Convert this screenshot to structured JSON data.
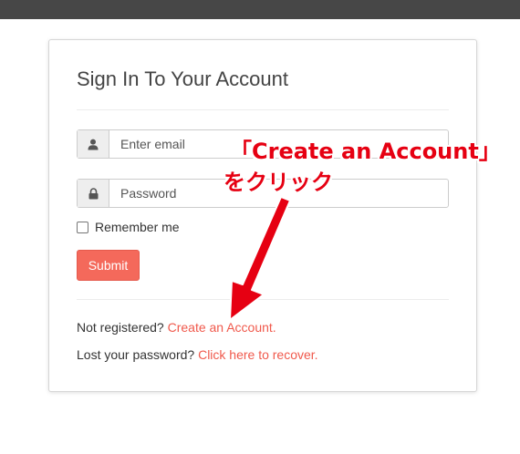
{
  "form": {
    "title": "Sign In To Your Account",
    "email_placeholder": "Enter email",
    "password_placeholder": "Password",
    "remember_label": "Remember me",
    "submit_label": "Submit",
    "not_registered_text": "Not registered? ",
    "create_account_link": "Create an Account.",
    "lost_password_text": "Lost your password? ",
    "recover_link": "Click here to recover."
  },
  "annotation": {
    "line1": "「Create an Account」",
    "line2": "をクリック",
    "color": "#e60012"
  },
  "icons": {
    "email_addon": "user-icon",
    "password_addon": "lock-icon"
  },
  "colors": {
    "accent": "#f4695b",
    "link": "#f0594c",
    "topbar": "#474747"
  }
}
